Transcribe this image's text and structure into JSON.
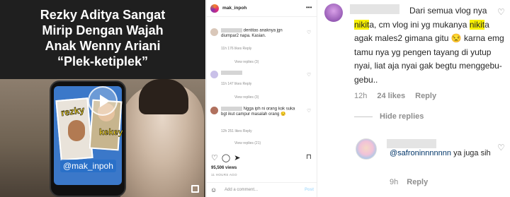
{
  "video": {
    "headline": [
      "Rezky Aditya Sangat",
      "Mirip Dengan Wajah",
      "Anak Wenny Ariani",
      "“Plek-ketiplek”"
    ],
    "sticker_left": "rezky",
    "sticker_right": "kekey",
    "watermark": "@mak_inpoh"
  },
  "post": {
    "username": "mak_inpoh",
    "comments": [
      {
        "text": "dentitas anaknya jgn diumpar2 napa. Kasian.",
        "meta": "11h   176 likes   Reply",
        "view": "View replies (3)"
      },
      {
        "text": "",
        "meta": "11h   147 likes   Reply",
        "view": "View replies (3)"
      },
      {
        "text": "Ngga iph ni orang kok suka bgt ikut campur masalah orang 😒",
        "meta": "12h   251 likes   Reply",
        "view": "View replies (21)"
      }
    ],
    "likes": "95,506 views",
    "time": "11 HOURS AGO",
    "add_placeholder": "Add a comment...",
    "post_label": "Post"
  },
  "thread": {
    "comment_before": "Dari semua vlog nya ",
    "hl1": "nikit",
    "comment_mid1": "a, cm vlog ini yg mukanya ",
    "hl2": "nikit",
    "comment_after": "a agak males2 gimana gitu 😒 karna emg tamu nya yg pengen tayang di yutup nyai, liat aja nyai gak begtu menggebu-gebu..",
    "time": "12h",
    "likes": "24 likes",
    "reply": "Reply",
    "hide_replies": "Hide replies",
    "reply_mention": "@safroninnnnnnn",
    "reply_text": " ya juga sih",
    "reply_time": "9h",
    "reply_reply": "Reply"
  }
}
